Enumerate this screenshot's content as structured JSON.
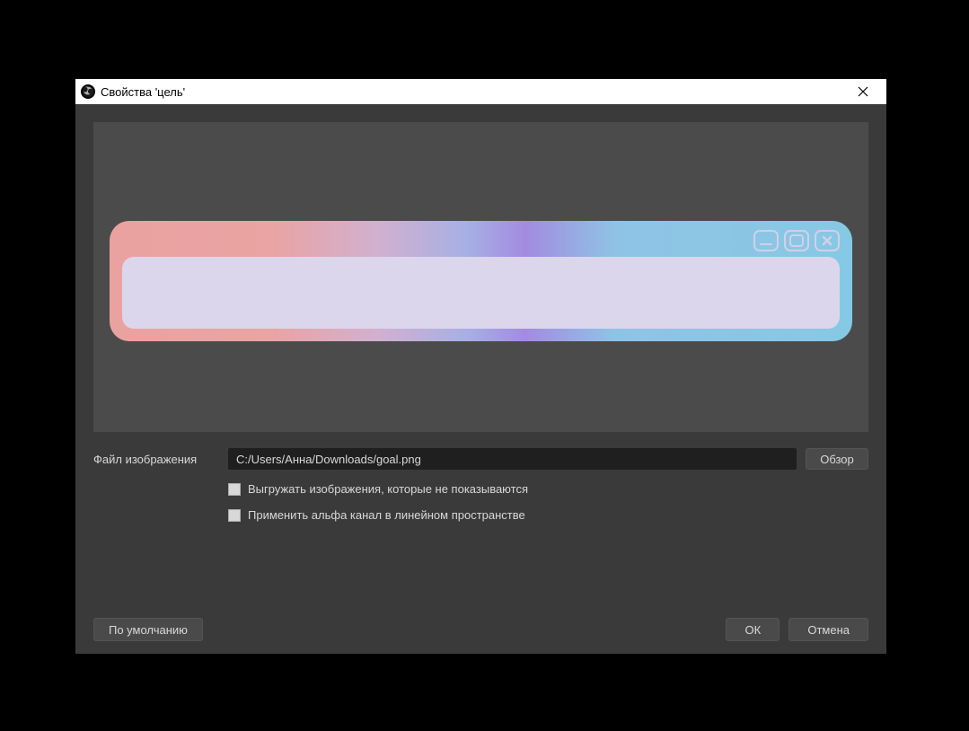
{
  "titlebar": {
    "title": "Свойства 'цель'"
  },
  "form": {
    "file_label": "Файл изображения",
    "file_path": "C:/Users/Анна/Downloads/goal.png",
    "browse_label": "Обзор",
    "unload_label": "Выгружать изображения, которые не показываются",
    "alpha_label": "Применить альфа канал в линейном пространстве"
  },
  "footer": {
    "defaults_label": "По умолчанию",
    "ok_label": "ОК",
    "cancel_label": "Отмена"
  }
}
